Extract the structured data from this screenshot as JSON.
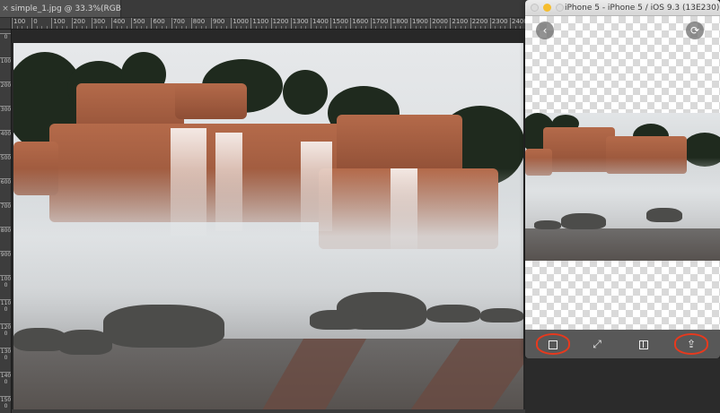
{
  "editor": {
    "document_tab": "simple_1.jpg @ 33.3%(RGB/8)",
    "close_glyph": "×",
    "ruler_top": [
      "100",
      "0",
      "100",
      "200",
      "300",
      "400",
      "500",
      "600",
      "700",
      "800",
      "900",
      "1000",
      "1100",
      "1200",
      "1300",
      "1400",
      "1500",
      "1600",
      "1700",
      "1800",
      "1900",
      "2000",
      "2100",
      "2200",
      "2300",
      "2400"
    ],
    "ruler_left": [
      "0",
      "1 0 0",
      "2 0 0",
      "3 0 0",
      "4 0 0",
      "5 0 0",
      "6 0 0",
      "7 0 0",
      "8 0 0",
      "9 0 0",
      "1 0 0 0",
      "1 1 0 0",
      "1 2 0 0",
      "1 3 0 0",
      "1 4 0 0",
      "1 5 0 0"
    ]
  },
  "simulator": {
    "window_title": "iPhone 5 - iPhone 5 / iOS 9.3 (13E230)",
    "nav": {
      "back_icon": "chevron-left-icon",
      "refresh_icon": "refresh-icon",
      "back_glyph": "‹",
      "refresh_glyph": "⟳"
    },
    "toolbar": [
      {
        "name": "save-image-button",
        "icon": "save-icon",
        "highlighted": true
      },
      {
        "name": "fullscreen-button",
        "icon": "fullscreen-icon",
        "glyph": "⤢",
        "highlighted": false
      },
      {
        "name": "compare-button",
        "icon": "compare-icon",
        "highlighted": false
      },
      {
        "name": "export-button",
        "icon": "export-icon",
        "glyph": "⇪",
        "highlighted": true
      }
    ],
    "highlight_color": "#e8391d"
  }
}
